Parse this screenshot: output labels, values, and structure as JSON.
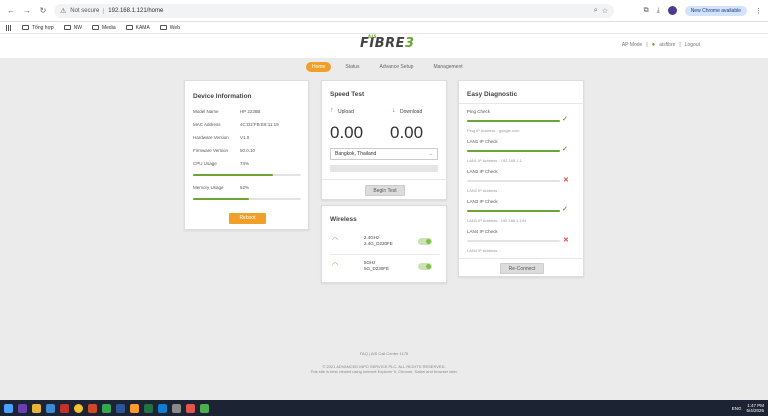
{
  "browser": {
    "url": "192.168.1.121/home",
    "security_label": "Not secure",
    "new_chrome_label": "New Chrome available",
    "bookmarks": [
      "Tổng hợp",
      "NW",
      "Media",
      "KAMA",
      "Web"
    ]
  },
  "header": {
    "logo_main": "FIBRE",
    "logo_three": "3",
    "logo_tag": "AIS",
    "ap_mode": "AP Mode",
    "separator": "|",
    "username": "aisfibre",
    "logout": "Logout"
  },
  "tabs": [
    "Home",
    "Status",
    "Advance Setup",
    "Management"
  ],
  "device_info": {
    "title": "Device Information",
    "rows": [
      {
        "label": "Model Name",
        "value": "HP 2238B"
      },
      {
        "label": "MAC Address",
        "value": "4C:D2:FB:E8:11:19"
      },
      {
        "label": "Hardware Version",
        "value": "V1.0"
      },
      {
        "label": "Firmware Version",
        "value": "50.0.10"
      },
      {
        "label": "CPU Usage",
        "value": "74%"
      },
      {
        "label": "Memory Usage",
        "value": "52%"
      }
    ],
    "cpu_usage_pct": 74,
    "memory_usage_pct": 52,
    "reboot_label": "Reboot"
  },
  "speed_test": {
    "title": "Speed Test",
    "upload_label": "Upload",
    "download_label": "Download",
    "upload_value": "0.00",
    "download_value": "0.00",
    "server": "Bangkok, Thailand",
    "begin_label": "Begin Test"
  },
  "wireless": {
    "title": "Wireless",
    "networks": [
      {
        "band": "2.4GHz",
        "ssid": "2.4G_D230FE",
        "enabled": true
      },
      {
        "band": "5GHz",
        "ssid": "5G_D230FE",
        "enabled": true
      }
    ]
  },
  "diagnostic": {
    "title": "Easy Diagnostic",
    "checks": [
      {
        "name": "Ping Check",
        "detail": "Ping IP Address : google.com",
        "status": "ok"
      },
      {
        "name": "LAN1 IP Check",
        "detail": "LAN1 IP Address : 192.168.1.1",
        "status": "ok"
      },
      {
        "name": "LAN2 IP Check",
        "detail": "LAN2 IP Address : -",
        "status": "fail"
      },
      {
        "name": "LAN3 IP Check",
        "detail": "LAN3 IP Address : 192.168.1.194",
        "status": "ok"
      },
      {
        "name": "LAN4 IP Check",
        "detail": "LAN4 IP Address : -",
        "status": "fail"
      }
    ],
    "reconnect_label": "Re-Connect"
  },
  "footer": {
    "line1": "FAQ | AIS Call Center 1175",
    "line2": "© 2021 ADVANCED INFO SERVICE PLC. ALL RIGHTS RESERVED.",
    "line3": "This site is best viewed using Internet Explorer 9, Chrome, Safari and browser later."
  },
  "taskbar": {
    "lang": "ENG",
    "time": "1:47 PM",
    "date": "5/4/2026"
  },
  "colors": {
    "accent_orange": "#f0a028",
    "accent_green": "#6aa536",
    "error_red": "#e0403a"
  }
}
